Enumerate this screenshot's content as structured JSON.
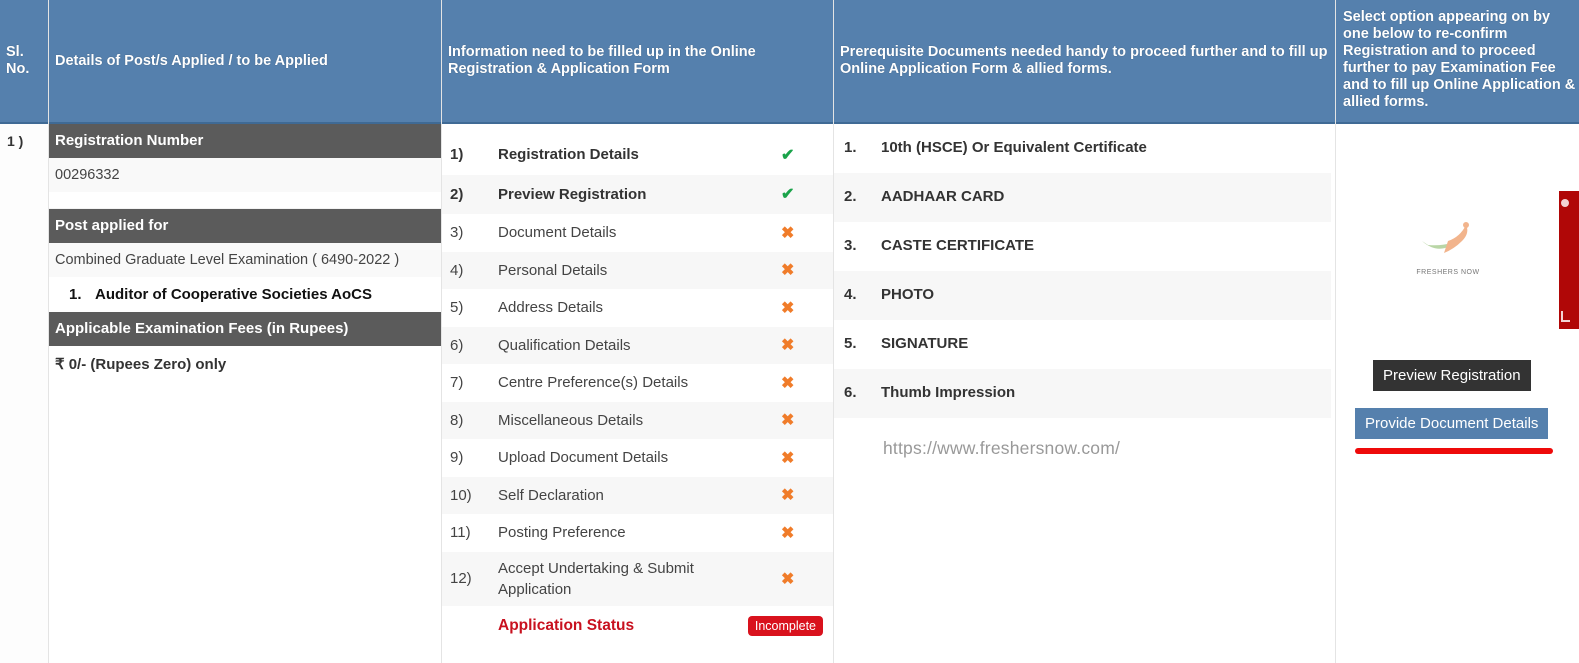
{
  "headers": {
    "sl_no": "Sl. No.",
    "post_details": "Details of Post/s Applied / to be Applied",
    "information": "Information need to be filled up in the Online Registration & Application Form",
    "prerequisites": "Prerequisite Documents needed handy to proceed further and to fill up Online Application Form & allied forms.",
    "select_option": "Select option appearing on by one below to re-confirm Registration and to proceed further to pay Examination Fee and to fill up Online Application & allied forms."
  },
  "row": {
    "sl_no": "1 )",
    "registration_number_label": "Registration Number",
    "registration_number": "00296332",
    "post_applied_label": "Post applied for",
    "post_applied": "Combined Graduate Level Examination ( 6490-2022 )",
    "posts": [
      {
        "num": "1.",
        "name": "Auditor of Cooperative Societies AoCS"
      }
    ],
    "fees_label": "Applicable Examination Fees (in Rupees)",
    "fees": "₹ 0/- (Rupees Zero) only"
  },
  "steps": [
    {
      "num": "1)",
      "label": "Registration Details",
      "status": "check-icon",
      "glyph": "✔"
    },
    {
      "num": "2)",
      "label": "Preview Registration",
      "status": "check-icon",
      "glyph": "✔"
    },
    {
      "num": "3)",
      "label": "Document Details",
      "status": "cross-icon",
      "glyph": "✖"
    },
    {
      "num": "4)",
      "label": "Personal Details",
      "status": "cross-icon",
      "glyph": "✖"
    },
    {
      "num": "5)",
      "label": "Address Details",
      "status": "cross-icon",
      "glyph": "✖"
    },
    {
      "num": "6)",
      "label": "Qualification Details",
      "status": "cross-icon",
      "glyph": "✖"
    },
    {
      "num": "7)",
      "label": "Centre Preference(s) Details",
      "status": "cross-icon",
      "glyph": "✖"
    },
    {
      "num": "8)",
      "label": "Miscellaneous Details",
      "status": "cross-icon",
      "glyph": "✖"
    },
    {
      "num": "9)",
      "label": "Upload Document Details",
      "status": "cross-icon",
      "glyph": "✖"
    },
    {
      "num": "10)",
      "label": "Self Declaration",
      "status": "cross-icon",
      "glyph": "✖"
    },
    {
      "num": "11)",
      "label": "Posting Preference",
      "status": "cross-icon",
      "glyph": "✖"
    },
    {
      "num": "12)",
      "label": "Accept Undertaking & Submit Application",
      "status": "cross-icon",
      "glyph": "✖"
    }
  ],
  "application_status": {
    "label": "Application Status",
    "value": "Incomplete"
  },
  "documents": [
    {
      "num": "1.",
      "name": "10th (HSCE) Or Equivalent Certificate"
    },
    {
      "num": "2.",
      "name": "AADHAAR CARD"
    },
    {
      "num": "3.",
      "name": "CASTE CERTIFICATE"
    },
    {
      "num": "4.",
      "name": "PHOTO"
    },
    {
      "num": "5.",
      "name": "SIGNATURE"
    },
    {
      "num": "6.",
      "name": "Thumb Impression"
    }
  ],
  "watermark": "https://www.freshersnow.com/",
  "logo_text": "FRESHERS NOW",
  "actions": {
    "preview_registration": "Preview Registration",
    "provide_document_details": "Provide Document Details"
  },
  "colors": {
    "header": "#5580ad",
    "bar": "#5b5b5b",
    "check": "#1aa34a",
    "cross": "#f07c2a",
    "status": "#c8111f",
    "highlight": "#ee0a0a"
  }
}
